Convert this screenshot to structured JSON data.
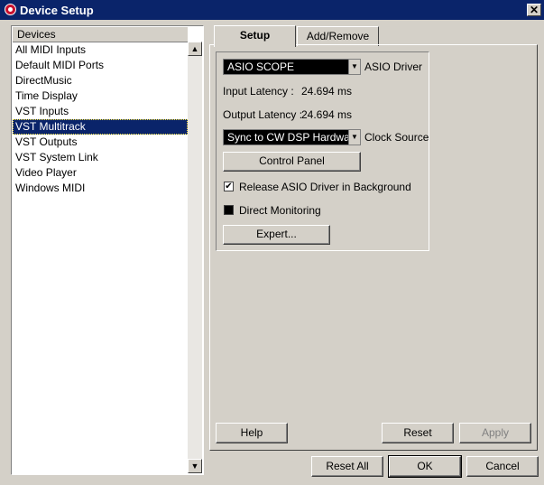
{
  "window": {
    "title": "Device Setup",
    "close_glyph": "✕"
  },
  "devices": {
    "header": "Devices",
    "items": [
      {
        "label": "All MIDI Inputs",
        "selected": false
      },
      {
        "label": "Default MIDI Ports",
        "selected": false
      },
      {
        "label": "DirectMusic",
        "selected": false
      },
      {
        "label": "Time Display",
        "selected": false
      },
      {
        "label": "VST Inputs",
        "selected": false
      },
      {
        "label": "VST Multitrack",
        "selected": true
      },
      {
        "label": "VST Outputs",
        "selected": false
      },
      {
        "label": "VST System Link",
        "selected": false
      },
      {
        "label": "Video Player",
        "selected": false
      },
      {
        "label": "Windows MIDI",
        "selected": false
      }
    ]
  },
  "tabs": [
    {
      "label": "Setup",
      "active": true
    },
    {
      "label": "Add/Remove",
      "active": false
    }
  ],
  "setup": {
    "asio_driver_value": "ASIO SCOPE",
    "asio_driver_label": "ASIO Driver",
    "input_latency_label": "Input Latency :",
    "input_latency_value": "24.694 ms",
    "output_latency_label": "Output Latency :",
    "output_latency_value": "24.694 ms",
    "clock_source_value": "Sync to CW DSP Hardware",
    "clock_source_label": "Clock Source",
    "control_panel_button": "Control Panel",
    "release_driver_label": "Release ASIO Driver in Background",
    "release_driver_checked": true,
    "direct_monitoring_label": "Direct Monitoring",
    "direct_monitoring_checked": false,
    "expert_button": "Expert..."
  },
  "pane_buttons": {
    "help": "Help",
    "reset": "Reset",
    "apply": "Apply"
  },
  "dialog_buttons": {
    "reset_all": "Reset All",
    "ok": "OK",
    "cancel": "Cancel"
  },
  "colors": {
    "titlebar": "#0a246a",
    "face": "#d4d0c8",
    "selection": "#0a246a"
  },
  "icons": {
    "dropdown": "▼",
    "scroll_up": "▲",
    "scroll_down": "▼",
    "check": "✔"
  }
}
